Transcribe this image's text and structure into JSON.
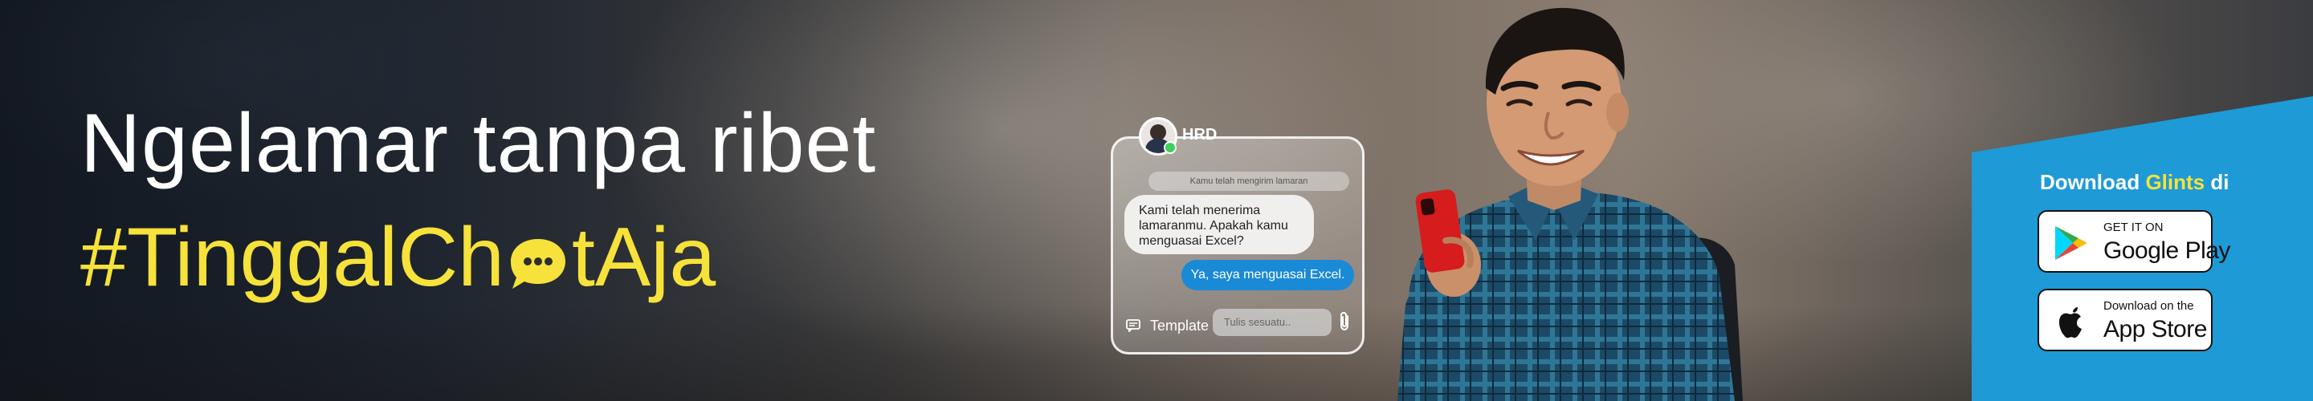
{
  "hero": {
    "headline": "Ngelamar tanpa ribet",
    "hashtag_before": "#TinggalCh",
    "hashtag_after": "tAja"
  },
  "chat": {
    "sender_name": "HRD",
    "system_note": "Kamu telah mengirim lamaran",
    "incoming_message": "Kami telah menerima\nlamaranmu. Apakah kamu\nmenguasai Excel?",
    "outgoing_message": "Ya, saya menguasai Excel.",
    "template_label": "Template",
    "input_placeholder": "Tulis sesuatu.."
  },
  "download": {
    "title_prefix": "Download",
    "brand": "Glints",
    "title_suffix": "di",
    "google_play_small": "GET IT ON",
    "google_play_big": "Google Play",
    "app_store_small": "Download on the",
    "app_store_big": "App Store"
  },
  "colors": {
    "accent_yellow": "#f6e23a",
    "panel_blue": "#1e9ad6",
    "outgoing_bubble": "#1a8ad6"
  },
  "icons": [
    "chat-bubble-icon",
    "template-icon",
    "paperclip-icon",
    "google-play-icon",
    "apple-icon",
    "avatar"
  ]
}
